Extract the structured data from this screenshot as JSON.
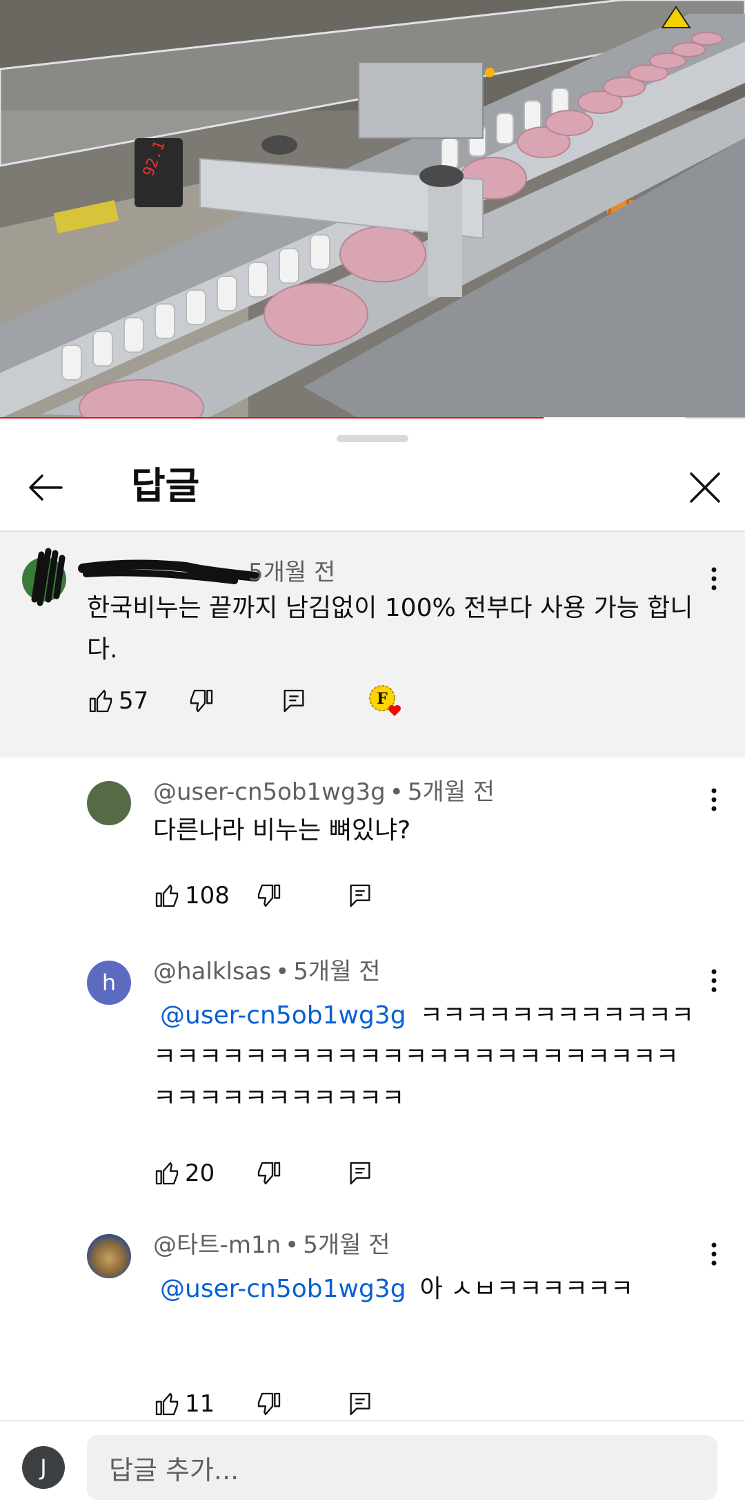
{
  "video": {
    "progress": 0.73,
    "buffered": 0.92,
    "display_readout": "92.1",
    "accent_color": "#ff0000"
  },
  "sheet": {
    "title": "답글",
    "back_icon": "arrow-left-icon",
    "close_icon": "close-icon"
  },
  "parent": {
    "age": "5개월 전",
    "text": "한국비누는   끝까지  남김없이  100%  전부다   사용 가능  합니다.",
    "likes": "57"
  },
  "replies": [
    {
      "author": "@user-cn5ob1wg3g",
      "age": "5개월 전",
      "mention": "",
      "text": "다른나라 비누는 뼈있냐?",
      "likes": "108"
    },
    {
      "author": "@halklsas",
      "age": "5개월 전",
      "avatar_letter": "h",
      "mention": "@user-cn5ob1wg3g",
      "text": "ㅋㅋㅋㅋㅋㅋㅋㅋㅋㅋㅋㅋㅋㅋㅋㅋㅋㅋㅋㅋㅋㅋㅋㅋㅋㅋㅋㅋㅋㅋㅋㅋㅋㅋㅋㅋㅋㅋㅋㅋㅋㅋㅋㅋㅋㅋ",
      "likes": "20"
    },
    {
      "author": "@타트-m1n",
      "age": "5개월 전",
      "mention": "@user-cn5ob1wg3g",
      "text": "아 ㅅㅂㅋㅋㅋㅋㅋㅋ",
      "likes": "11"
    }
  ],
  "reply_bar": {
    "user_initial": "J",
    "placeholder": "답글 추가..."
  },
  "meta": {
    "dot": "•"
  }
}
